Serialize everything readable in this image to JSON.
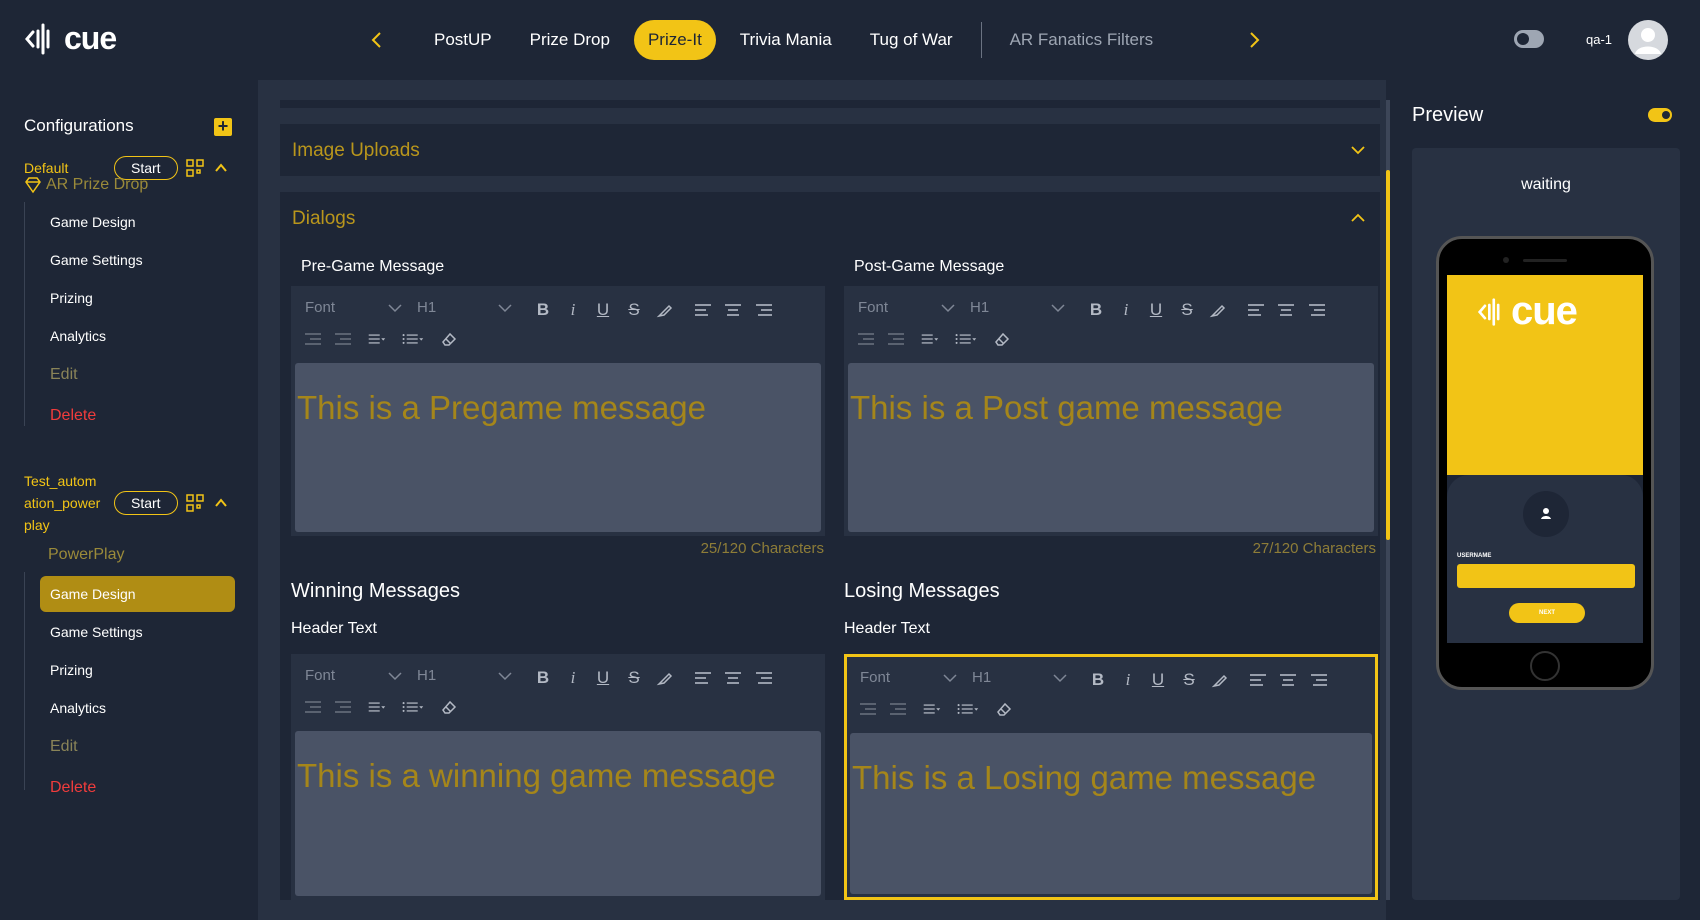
{
  "app": {
    "logo_text": "cue",
    "user_name": "qa-1"
  },
  "tabs": [
    {
      "label": "PostUP"
    },
    {
      "label": "Prize Drop"
    },
    {
      "label": "Prize-It"
    },
    {
      "label": "Trivia Mania"
    },
    {
      "label": "Tug of War"
    },
    {
      "label": "AR Fanatics Filters"
    }
  ],
  "sidebar": {
    "title": "Configurations",
    "configs": [
      {
        "name": "Default",
        "start_label": "Start",
        "game_type": "AR Prize Drop",
        "items": [
          "Game Design",
          "Game Settings",
          "Prizing",
          "Analytics",
          "Edit",
          "Delete"
        ]
      },
      {
        "name": "Test_autom ation_power play",
        "start_label": "Start",
        "game_type": "PowerPlay",
        "items": [
          "Game Design",
          "Game Settings",
          "Prizing",
          "Analytics",
          "Edit",
          "Delete"
        ]
      }
    ]
  },
  "main": {
    "image_uploads_title": "Image Uploads",
    "dialogs_title": "Dialogs",
    "pregame": {
      "label": "Pre-Game Message",
      "text": "This is a Pregame message",
      "count": "25/120 Characters"
    },
    "postgame": {
      "label": "Post-Game Message",
      "text": "This is a Post game message",
      "count": "27/120 Characters"
    },
    "winning": {
      "title": "Winning Messages",
      "label": "Header Text",
      "text": "This is a winning game message"
    },
    "losing": {
      "title": "Losing Messages",
      "label": "Header Text",
      "text": "This is a Losing game message"
    },
    "toolbar": {
      "font_placeholder": "Font",
      "heading_value": "H1"
    }
  },
  "preview": {
    "title": "Preview",
    "state": "waiting",
    "logo_text": "cue",
    "username_label": "USERNAME",
    "next_label": "NEXT"
  },
  "colors": {
    "accent": "#f2c416",
    "background": "#1e2636",
    "panel": "#283142",
    "danger": "#f03c3c"
  }
}
